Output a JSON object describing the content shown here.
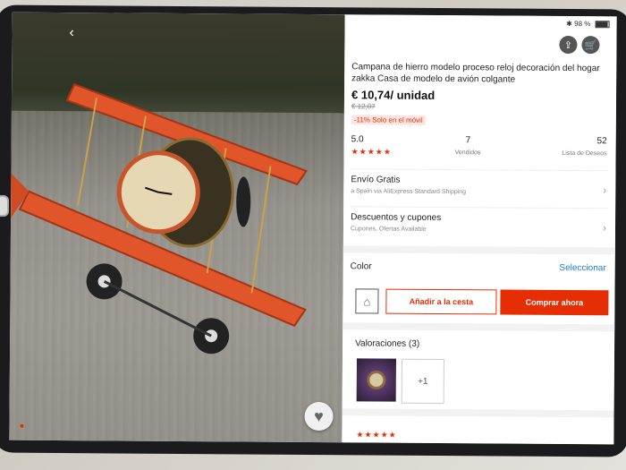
{
  "status": {
    "battery": "98 %"
  },
  "header": {
    "share_icon": "share-icon",
    "cart_icon": "cart-icon"
  },
  "product": {
    "title": "Campana de hierro modelo proceso reloj decoración del hogar zakka Casa de modelo de avión colgante",
    "price": "€ 10,74/ unidad",
    "old_price": "€ 12,07",
    "promo": "-11% Solo en el móvil"
  },
  "stats": {
    "rating": "5.0",
    "rating_stars": "★★★★★",
    "sold_count": "7",
    "sold_label": "Vendidos",
    "wishlist_count": "52",
    "wishlist_label": "Lista de Deseos"
  },
  "shipping": {
    "title": "Envío Gratis",
    "subtitle": "a Spain via AliExpress Standard Shipping"
  },
  "discounts": {
    "title": "Descuentos y cupones",
    "subtitle": "Cupones, Ofertas Available"
  },
  "color": {
    "label": "Color",
    "action": "Seleccionar"
  },
  "actions": {
    "add_to_cart": "Añadir a la cesta",
    "buy_now": "Comprar ahora"
  },
  "reviews": {
    "title": "Valoraciones (3)",
    "more": "+1",
    "stars": "★★★★★"
  },
  "colors": {
    "accent": "#e62e04",
    "link": "#1a7bd6"
  }
}
